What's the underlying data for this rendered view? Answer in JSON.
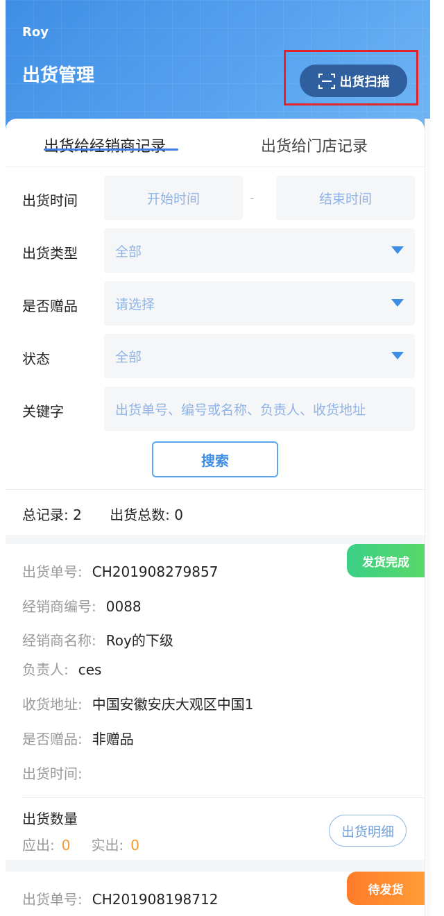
{
  "header": {
    "user_name": "Roy",
    "title": "出货管理",
    "scan_button_label": "出货扫描",
    "scan_icon": "scan-frame-icon"
  },
  "tabs": [
    {
      "label": "出货给经销商记录",
      "active": true
    },
    {
      "label": "出货给门店记录",
      "active": false
    }
  ],
  "filters": {
    "time_label": "出货时间",
    "start_placeholder": "开始时间",
    "range_separator": "-",
    "end_placeholder": "结束时间",
    "type_label": "出货类型",
    "type_value": "全部",
    "gift_label": "是否赠品",
    "gift_placeholder": "请选择",
    "status_label": "状态",
    "status_value": "全部",
    "keyword_label": "关键字",
    "keyword_placeholder": "出货单号、编号或名称、负责人、收货地址",
    "search_label": "搜索"
  },
  "summary": {
    "total_records": "总记录: 2",
    "total_shipped": "出货总数: 0"
  },
  "records": [
    {
      "status": "发货完成",
      "order_no_label": "出货单号:",
      "order_no": "CH201908279857",
      "dealer_code_label": "经销商编号:",
      "dealer_code": "0088",
      "dealer_name_label": "经销商名称:",
      "dealer_name": "Roy的下级",
      "owner_label": "负责人:",
      "owner": "ces",
      "address_label": "收货地址:",
      "address": "中国安徽安庆大观区中国1",
      "gift_label": "是否赠品:",
      "gift": "非赠品",
      "time_label": "出货时间:",
      "time": "",
      "qty_title": "出货数量",
      "should_label": "应出:",
      "should_value": "0",
      "actual_label": "实出:",
      "actual_value": "0",
      "detail_label": "出货明细"
    },
    {
      "status": "待发货",
      "order_no_label": "出货单号:",
      "order_no": "CH201908198712"
    }
  ],
  "colors": {
    "header_blue": "#3f8ee6",
    "highlight_red": "#e0242a",
    "done_green": "#3ccf86",
    "pending_orange": "#ff7b2a",
    "qty_orange": "#f39a2c"
  }
}
